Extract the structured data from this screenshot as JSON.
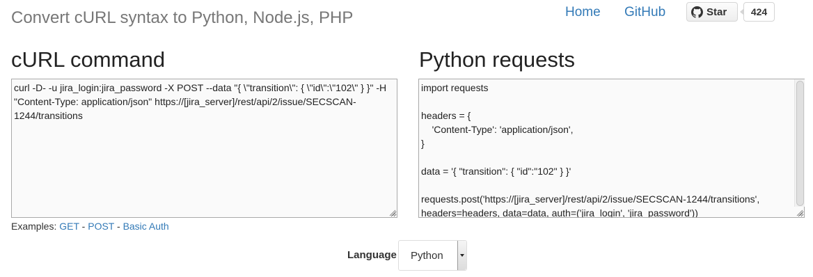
{
  "header": {
    "title": "Convert cURL syntax to Python, Node.js, PHP",
    "nav": {
      "home": "Home",
      "github": "GitHub"
    },
    "github_button": {
      "star_label": "Star",
      "star_count": "424"
    }
  },
  "left_panel": {
    "heading": "cURL command",
    "curl_text": "curl -D- -u jira_login:jira_password -X POST --data \"{ \\\"transition\\\": { \\\"id\\\":\\\"102\\\" } }\" -H \"Content-Type: application/json\" https://[jira_server]/rest/api/2/issue/SECSCAN-1244/transitions"
  },
  "right_panel": {
    "heading": "Python requests",
    "output_text": "import requests\n\nheaders = {\n    'Content-Type': 'application/json',\n}\n\ndata = '{ \"transition\": { \"id\":\"102\" } }'\n\nrequests.post('https://[jira_server]/rest/api/2/issue/SECSCAN-1244/transitions', headers=headers, data=data, auth=('jira_login', 'jira_password'))"
  },
  "examples": {
    "label": "Examples:",
    "separator": "-",
    "links": [
      "GET",
      "POST",
      "Basic Auth"
    ]
  },
  "language": {
    "label": "Language",
    "selected": "Python"
  },
  "colors": {
    "link": "#337ab7",
    "title": "#777777"
  }
}
